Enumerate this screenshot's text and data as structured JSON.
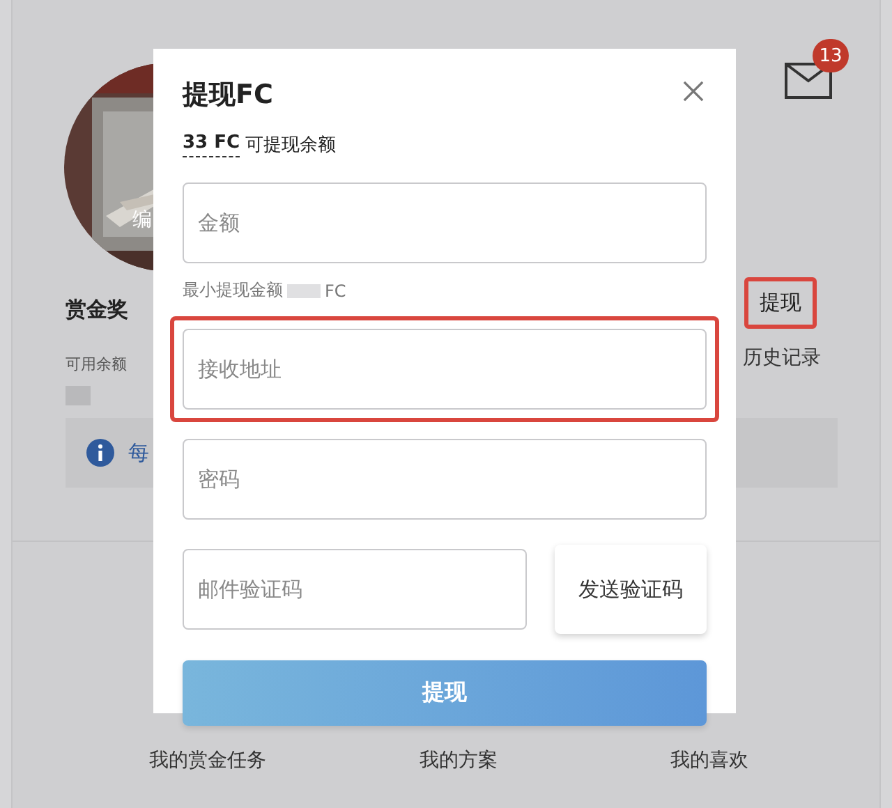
{
  "background": {
    "avatar": {
      "overlay_label": "编"
    },
    "title": "赏金奖",
    "balance_label": "可用余额",
    "notice": {
      "text": "每"
    },
    "mail": {
      "badge": "13"
    },
    "withdraw_button": {
      "label": "提现",
      "highlighted": true
    },
    "history_link": "历史记录",
    "nav": [
      {
        "label": "我的赏金任务"
      },
      {
        "label": "我的方案"
      },
      {
        "label": "我的喜欢"
      }
    ]
  },
  "dialog": {
    "title": "提现FC",
    "balance": {
      "amount": "33 FC",
      "label": "可提现余额"
    },
    "amount_field": {
      "placeholder": "金额",
      "highlighted": false
    },
    "min_hint": {
      "prefix": "最小提现金额",
      "suffix": "FC"
    },
    "address_field": {
      "placeholder": "接收地址",
      "highlighted": true
    },
    "password_field": {
      "placeholder": "密码",
      "highlighted": false
    },
    "code_field": {
      "placeholder": "邮件验证码",
      "highlighted": false
    },
    "send_code_button": "发送验证码",
    "submit_button": "提现"
  }
}
